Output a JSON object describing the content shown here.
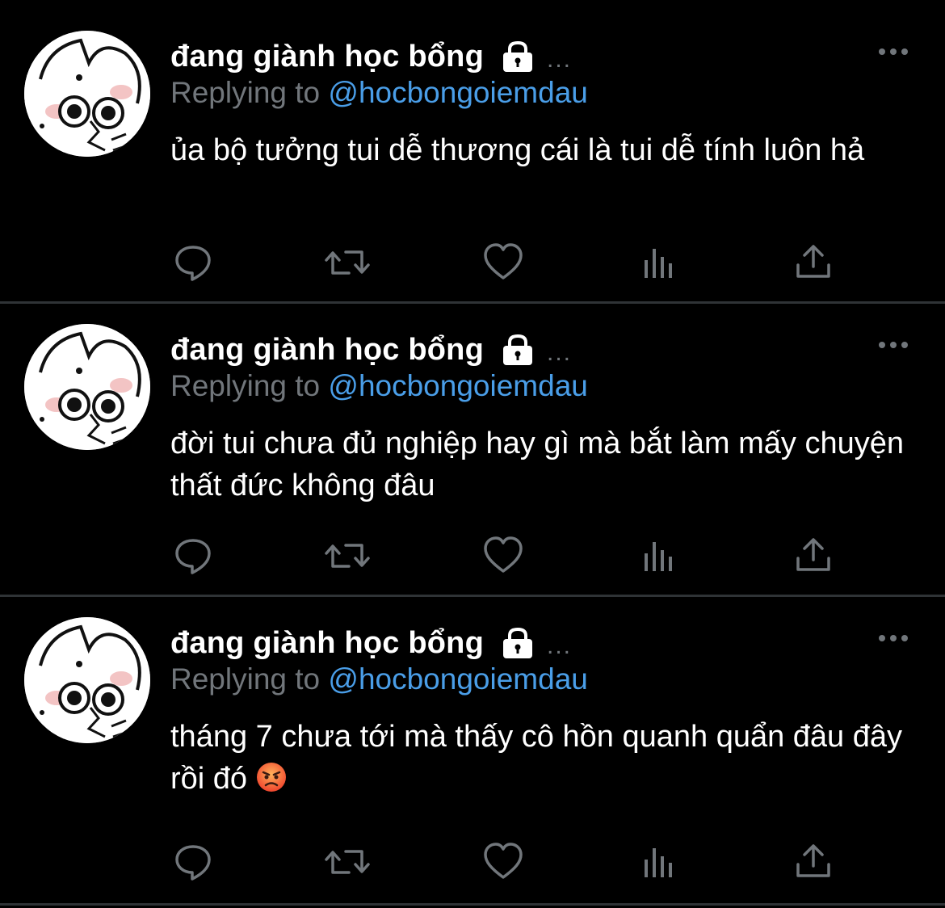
{
  "tweets": [
    {
      "name": "đang giành học bổng",
      "ellipsis": "...",
      "replying_prefix": "Replying to ",
      "handle": "@hocbongoiemdau",
      "text": "ủa bộ tưởng tui dễ thương cái là tui dễ tính luôn hả",
      "emoji": ""
    },
    {
      "name": "đang giành học bổng",
      "ellipsis": "...",
      "replying_prefix": "Replying to ",
      "handle": "@hocbongoiemdau",
      "text": "đời tui chưa đủ nghiệp hay gì mà bắt làm mấy chuyện thất đức không đâu",
      "emoji": ""
    },
    {
      "name": "đang giành học bổng",
      "ellipsis": "...",
      "replying_prefix": "Replying to ",
      "handle": "@hocbongoiemdau",
      "text": "tháng 7 chưa tới mà thấy cô hồn quanh quẩn đâu đây rồi đó",
      "emoji": "angry-face"
    }
  ],
  "icons": {
    "lock": "lock-icon",
    "more": "more-options-icon",
    "reply": "reply-icon",
    "retweet": "retweet-icon",
    "like": "like-icon",
    "views": "views-icon",
    "share": "share-icon"
  },
  "colors": {
    "background": "#000000",
    "text": "#ffffff",
    "muted": "#71767b",
    "link": "#4a9ee8",
    "divider": "#2f3336",
    "icon": "#71767b"
  }
}
